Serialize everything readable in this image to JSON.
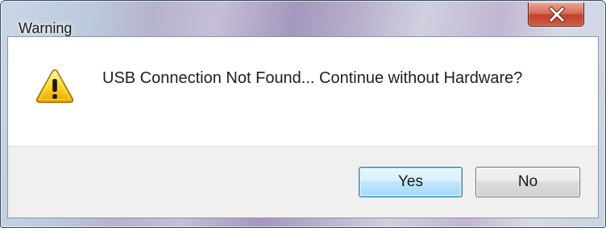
{
  "window": {
    "title": "Warning"
  },
  "titlebar": {
    "close_icon": "close-icon",
    "close_color": "#c8452d"
  },
  "dialog": {
    "icon": "warning-icon",
    "icon_color": "#f5c400",
    "message": "USB Connection Not Found... Continue without Hardware?"
  },
  "buttons": {
    "yes_label": "Yes",
    "no_label": "No",
    "default": "Yes",
    "default_highlight_color": "#3c7fb1"
  }
}
